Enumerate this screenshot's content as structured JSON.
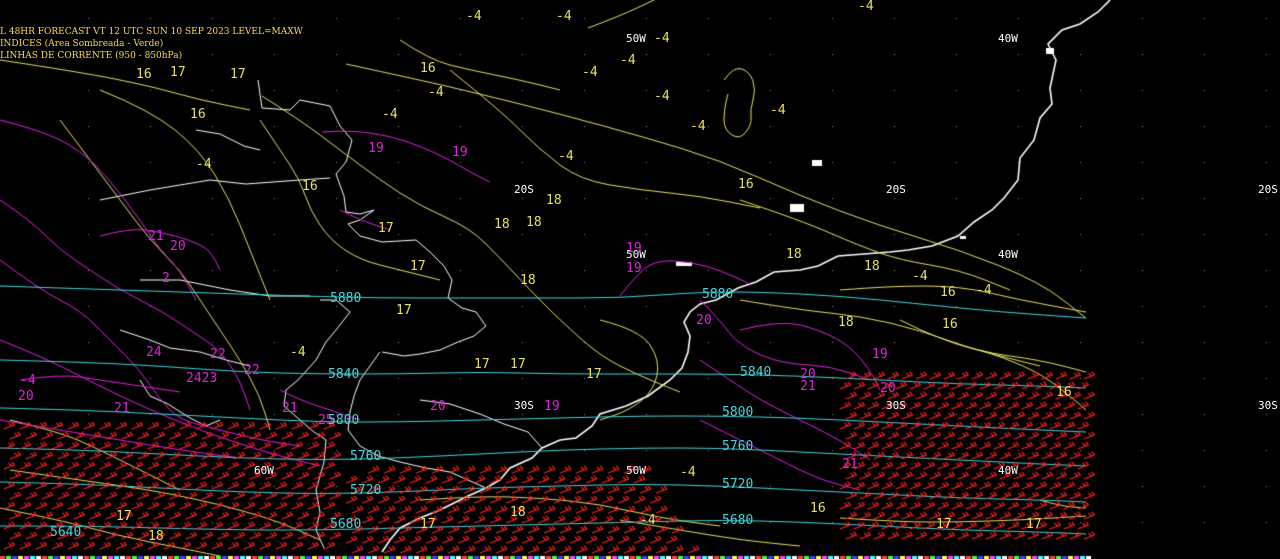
{
  "header": {
    "line1": "L 48HR FORECAST   VT 12 UTC SUN 10 SEP 2023   LEVEL=MAXW",
    "line2": "INDICES (Area Sombreada - Verde)",
    "line3": "LINHAS DE CORRENTE (950 - 850hPa)"
  },
  "colors": {
    "background": "#000000",
    "coast": "#ffffff",
    "header_text": "#ffd84a",
    "yellow_contours": "#e8e060",
    "magenta_contours": "#e020e0",
    "cyan_contours": "#40d8e0",
    "wind_barbs": "#ff2020",
    "grid_labels": "#ffffff"
  },
  "grid_labels": {
    "lon_40w_a": "40W",
    "lon_40w_b": "40W",
    "lon_40w_c": "40W",
    "lon_50w_a": "50W",
    "lon_50w_b": "50W",
    "lon_50w_c": "50W",
    "lon_60w": "60W",
    "lat_20s_a": "20S",
    "lat_20s_b": "20S",
    "lat_20s_c": "20S",
    "lat_30s_a": "30S",
    "lat_30s_b": "30S",
    "lat_30s_c": "30S"
  },
  "yellow_labels": {
    "y1": "-4",
    "y2": "-4",
    "y3": "-4",
    "y4": "-4",
    "y5": "-4",
    "y6": "-4",
    "y7": "-4",
    "y8": "-4",
    "y9": "-4",
    "y10": "-4",
    "y11": "-4",
    "y12": "-4",
    "y13": "16",
    "y14": "17",
    "y15": "17",
    "y16": "16",
    "y17": "16",
    "y18": "16",
    "y19": "17",
    "y20": "16",
    "y21": "18",
    "y22": "18",
    "y23": "18",
    "y24": "17",
    "y25": "17",
    "y26": "18",
    "y27": "18",
    "y28": "18",
    "y29": "16",
    "y30": "17",
    "y31": "17",
    "y32": "17",
    "y33": "18",
    "y34": "16",
    "y35": "16",
    "y36": "17",
    "y37": "16",
    "y38": "18",
    "y39": "17",
    "y40": "17",
    "y41": "-4",
    "y42": "-4",
    "y43": "-4",
    "y44": "-4",
    "y45": "-4",
    "y46": "-4",
    "y47": "18",
    "y48": "17"
  },
  "magenta_labels": {
    "m1": "19",
    "m2": "19",
    "m3": "19",
    "m4": "19",
    "m5": "21",
    "m6": "20",
    "m7": "2",
    "m8": "24",
    "m9": "2423",
    "m10": "22",
    "m11": "21",
    "m12": "25",
    "m13": "20",
    "m14": "20",
    "m15": "21",
    "m16": "20",
    "m17": "20",
    "m18": "19",
    "m19": "19",
    "m20": "20",
    "m21": "21",
    "m22": "21",
    "m23": "22",
    "m24": "-4"
  },
  "cyan_labels": {
    "c1": "5880",
    "c2": "5880",
    "c3": "5840",
    "c4": "5840",
    "c5": "5800",
    "c6": "5800",
    "c7": "5760",
    "c8": "5760",
    "c9": "5720",
    "c10": "5720",
    "c11": "5680",
    "c12": "5640",
    "c13": "5680"
  }
}
